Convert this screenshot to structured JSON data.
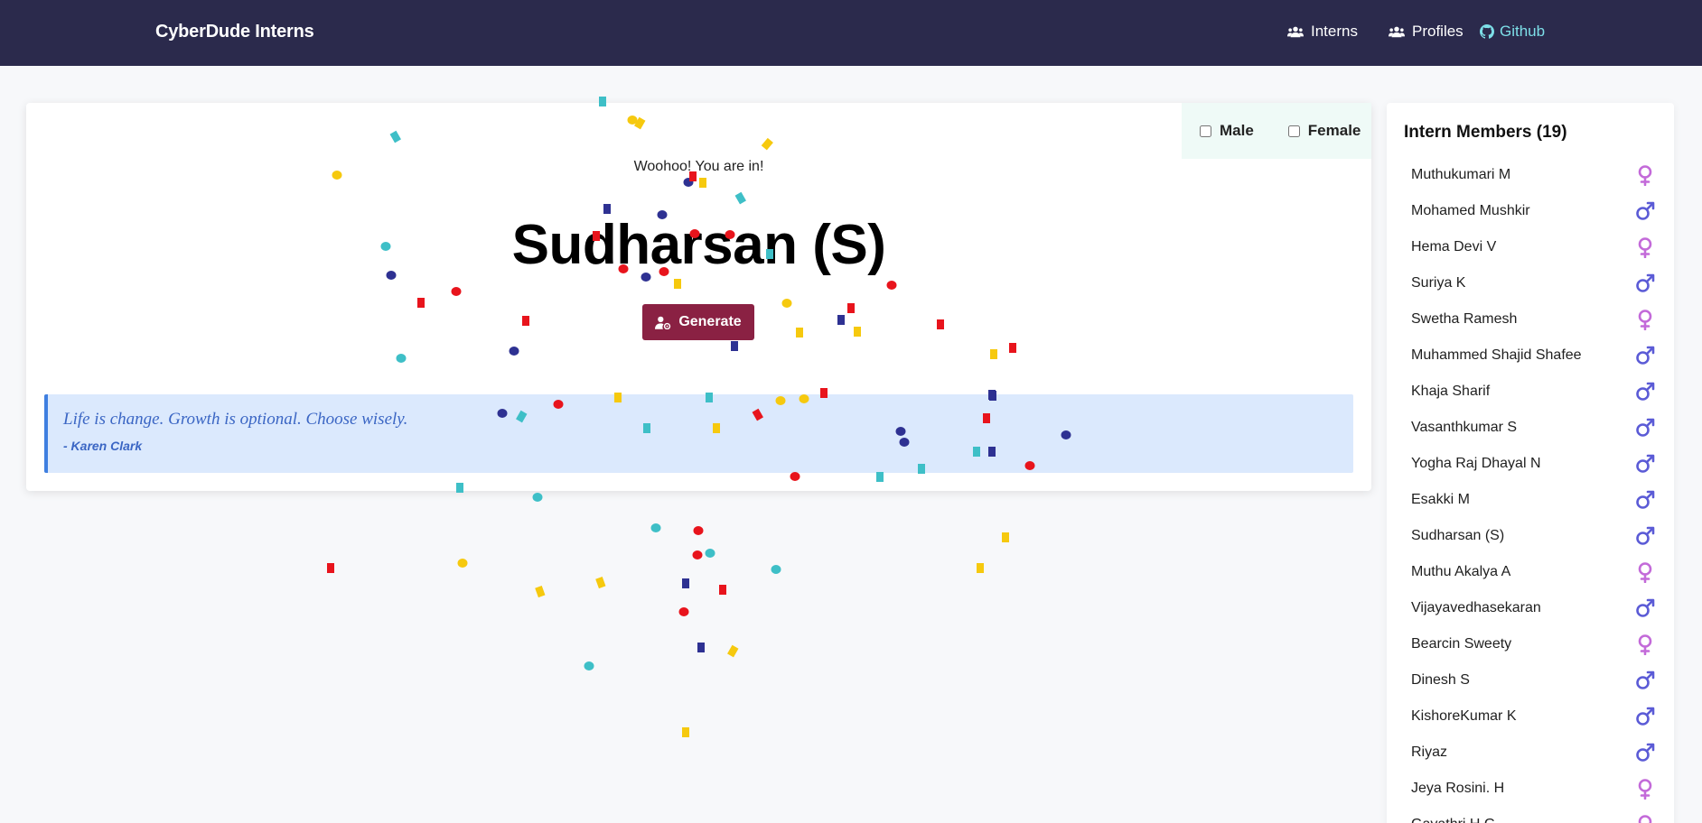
{
  "navbar": {
    "brand": "CyberDude Interns",
    "links": [
      {
        "label": "Interns",
        "icon": "users-icon"
      },
      {
        "label": "Profiles",
        "icon": "users-icon"
      },
      {
        "label": "Github",
        "icon": "github-icon"
      }
    ]
  },
  "filters": {
    "male_label": "Male",
    "female_label": "Female",
    "male_checked": false,
    "female_checked": false
  },
  "main": {
    "subtitle": "Woohoo! You are in!",
    "winner": "Sudharsan (S)",
    "generate_label": "Generate",
    "generate_icon": "user-gear-icon"
  },
  "quote": {
    "text": "Life is change. Growth is optional. Choose wisely.",
    "author": "- Karen Clark"
  },
  "sidebar": {
    "title": "Intern Members (19)",
    "members": [
      {
        "name": "Muthukumari M",
        "gender": "female"
      },
      {
        "name": "Mohamed Mushkir",
        "gender": "male"
      },
      {
        "name": "Hema Devi V",
        "gender": "female"
      },
      {
        "name": "Suriya K",
        "gender": "male"
      },
      {
        "name": "Swetha Ramesh",
        "gender": "female"
      },
      {
        "name": "Muhammed Shajid Shafee",
        "gender": "male"
      },
      {
        "name": "Khaja Sharif",
        "gender": "male"
      },
      {
        "name": "Vasanthkumar S",
        "gender": "male"
      },
      {
        "name": "Yogha Raj Dhayal N",
        "gender": "male"
      },
      {
        "name": "Esakki M",
        "gender": "male"
      },
      {
        "name": "Sudharsan (S)",
        "gender": "male"
      },
      {
        "name": "Muthu Akalya A",
        "gender": "female"
      },
      {
        "name": "Vijayavedhasekaran",
        "gender": "male"
      },
      {
        "name": "Bearcin Sweety",
        "gender": "female"
      },
      {
        "name": "Dinesh S",
        "gender": "male"
      },
      {
        "name": "KishoreKumar K",
        "gender": "male"
      },
      {
        "name": "Riyaz",
        "gender": "male"
      },
      {
        "name": "Jeya Rosini. H",
        "gender": "female"
      },
      {
        "name": "Gayathri H G",
        "gender": "female"
      }
    ]
  },
  "colors": {
    "navbar_bg": "#2b2a4c",
    "github_link": "#7ddfe8",
    "generate_bg": "#8a2143",
    "quote_bg": "#dbe9fd",
    "quote_text": "#3b66c4",
    "male_icon": "#5b5bd6",
    "female_icon": "#c36ad9",
    "confetti": [
      "#e8141c",
      "#f6c90e",
      "#2e3192",
      "#3ebfc7"
    ]
  }
}
